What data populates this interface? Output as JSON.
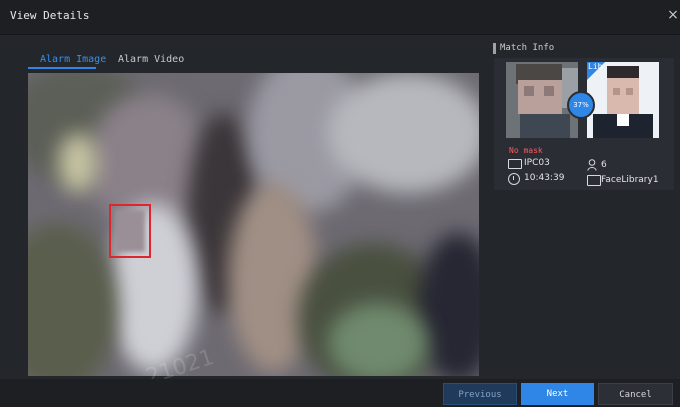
{
  "dialog": {
    "title": "View Details",
    "close_icon": "close-icon"
  },
  "tabs": [
    {
      "label": "Alarm Image",
      "active": true
    },
    {
      "label": "Alarm Video",
      "active": false
    }
  ],
  "watermark": "21021",
  "match_info": {
    "title": "Match Info",
    "similarity": "37%",
    "library_tag": "Lib",
    "mask_status": "No mask",
    "camera": "IPC03",
    "time": "10:43:39",
    "match_count": "6",
    "library_name": "FaceLibrary1"
  },
  "buttons": {
    "previous": "Previous",
    "next": "Next",
    "cancel": "Cancel"
  },
  "colors": {
    "accent": "#2f86e6",
    "alert": "#ff5a5f",
    "face_box": "#e0252c"
  }
}
